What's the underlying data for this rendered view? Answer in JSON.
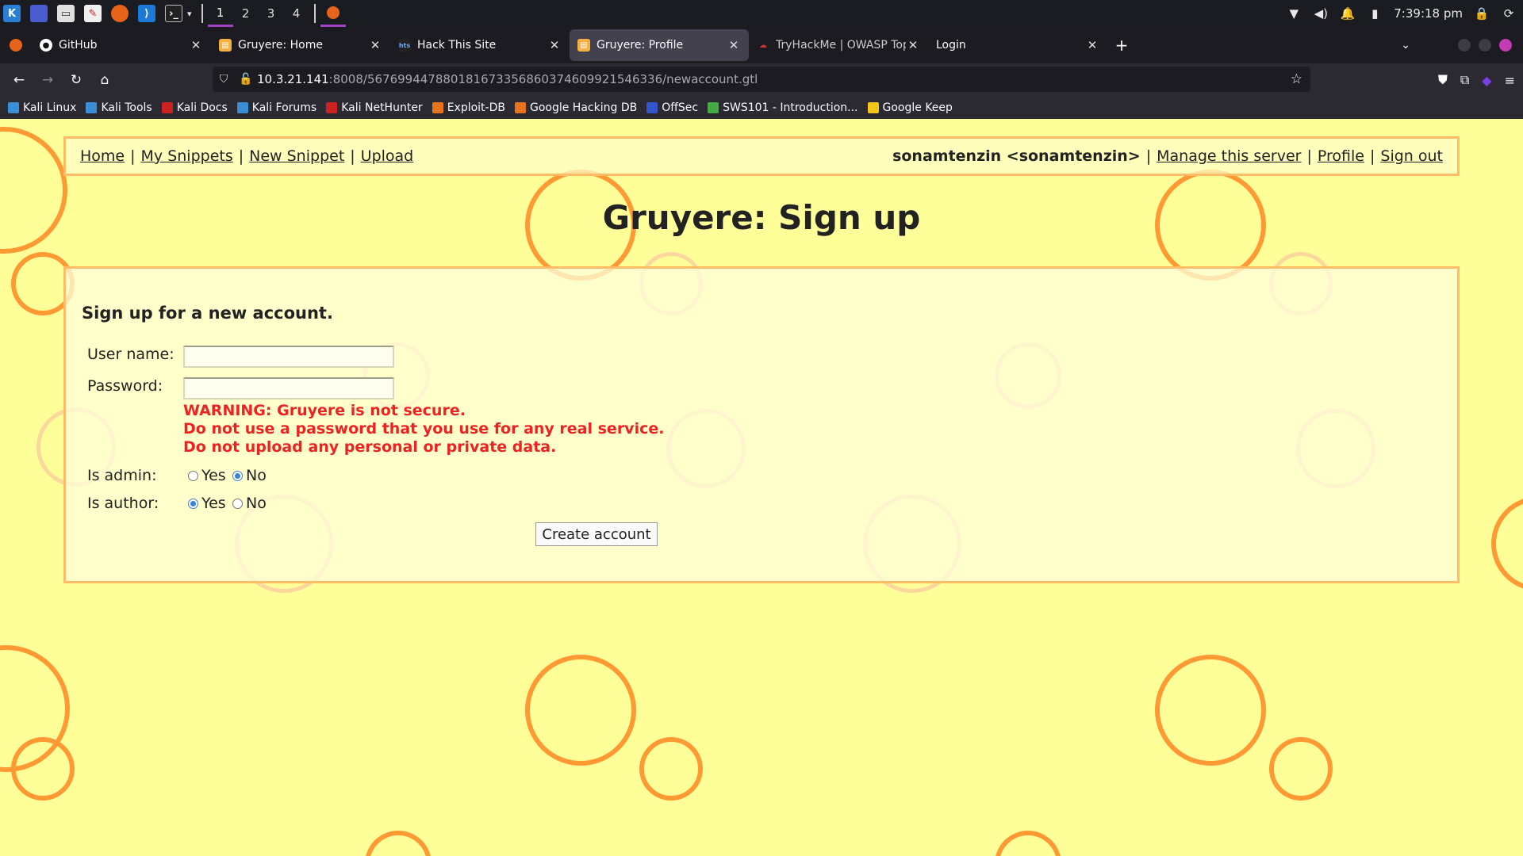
{
  "taskbar": {
    "workspaces": [
      "1",
      "2",
      "3",
      "4"
    ],
    "clock": "7:39:18 pm"
  },
  "tabs": [
    {
      "title": "GitHub",
      "active": false
    },
    {
      "title": "Gruyere: Home",
      "active": false
    },
    {
      "title": "Hack This Site",
      "active": false
    },
    {
      "title": "Gruyere: Profile",
      "active": true
    },
    {
      "title": "TryHackMe | OWASP Top",
      "active": false
    },
    {
      "title": "Login",
      "active": false
    }
  ],
  "address": {
    "host": "10.3.21.141",
    "rest": ":8008/567699447880181673356860374609921546336/newaccount.gtl"
  },
  "bookmarks": [
    {
      "label": "Kali Linux",
      "color": "#3a8fd6"
    },
    {
      "label": "Kali Tools",
      "color": "#3a8fd6"
    },
    {
      "label": "Kali Docs",
      "color": "#cc2222"
    },
    {
      "label": "Kali Forums",
      "color": "#3a8fd6"
    },
    {
      "label": "Kali NetHunter",
      "color": "#cc2222"
    },
    {
      "label": "Exploit-DB",
      "color": "#e8731a"
    },
    {
      "label": "Google Hacking DB",
      "color": "#e8731a"
    },
    {
      "label": "OffSec",
      "color": "#3355cc"
    },
    {
      "label": "SWS101 - Introduction...",
      "color": "#44aa44"
    },
    {
      "label": "Google Keep",
      "color": "#f5c518"
    }
  ],
  "menu": {
    "home": "Home",
    "my_snippets": "My Snippets",
    "new_snippet": "New Snippet",
    "upload": "Upload",
    "user": "sonamtenzin <sonamtenzin>",
    "manage": "Manage this server",
    "profile": "Profile",
    "sign_out": "Sign out",
    "separator": "|"
  },
  "page": {
    "title": "Gruyere: Sign up",
    "heading": "Sign up for a new account.",
    "username_label": "User name:",
    "password_label": "Password:",
    "warning_lines": [
      "WARNING: Gruyere is not secure.",
      "Do not use a password that you use for any real service.",
      "Do not upload any personal or private data."
    ],
    "is_admin_label": "Is admin:",
    "is_author_label": "Is author:",
    "yes": "Yes",
    "no": "No",
    "create_button": "Create account"
  },
  "colors": {
    "page_bg": "#ffff99",
    "circle": "#ff9933",
    "warning": "#ee2222",
    "box_border": "#ffbb66"
  }
}
